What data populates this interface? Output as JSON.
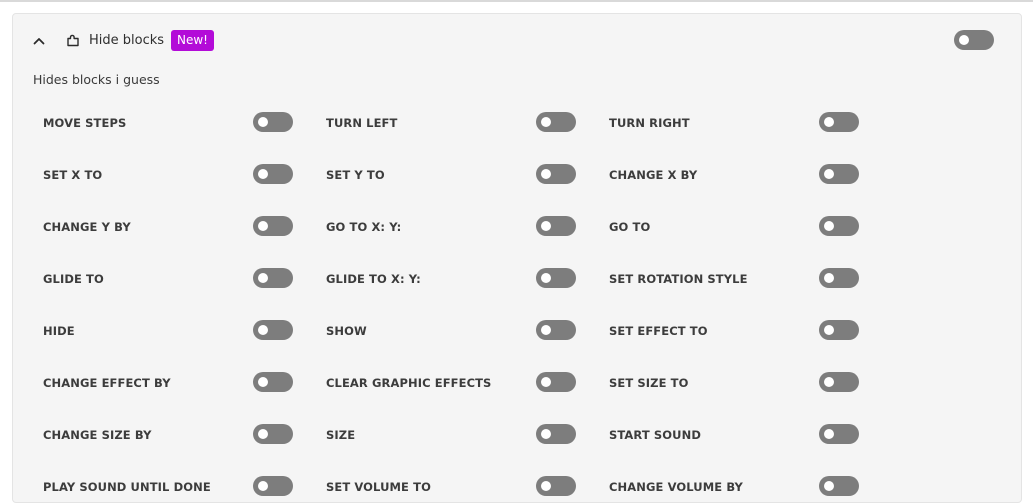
{
  "addon": {
    "name": "Hide blocks",
    "badge": "New!",
    "description": "Hides blocks i guess",
    "enabled": false
  },
  "colors": {
    "badge": "#b30bd8",
    "toggle_off": "#7d7d7d",
    "card_bg": "#f5f5f5"
  },
  "icons": {
    "collapse": "chevron-up-icon",
    "addon": "puzzle-icon"
  },
  "settings": [
    [
      {
        "label": "MOVE STEPS",
        "enabled": false
      },
      {
        "label": "TURN LEFT",
        "enabled": false
      },
      {
        "label": "TURN RIGHT",
        "enabled": false
      }
    ],
    [
      {
        "label": "SET X TO",
        "enabled": false
      },
      {
        "label": "SET Y TO",
        "enabled": false
      },
      {
        "label": "CHANGE X BY",
        "enabled": false
      }
    ],
    [
      {
        "label": "CHANGE Y BY",
        "enabled": false
      },
      {
        "label": "GO TO X: Y:",
        "enabled": false
      },
      {
        "label": "GO TO",
        "enabled": false
      }
    ],
    [
      {
        "label": "GLIDE TO",
        "enabled": false
      },
      {
        "label": "GLIDE TO X: Y:",
        "enabled": false
      },
      {
        "label": "SET ROTATION STYLE",
        "enabled": false
      }
    ],
    [
      {
        "label": "HIDE",
        "enabled": false
      },
      {
        "label": "SHOW",
        "enabled": false
      },
      {
        "label": "SET EFFECT TO",
        "enabled": false
      }
    ],
    [
      {
        "label": "CHANGE EFFECT BY",
        "enabled": false
      },
      {
        "label": "CLEAR GRAPHIC EFFECTS",
        "enabled": false
      },
      {
        "label": "SET SIZE TO",
        "enabled": false
      }
    ],
    [
      {
        "label": "CHANGE SIZE BY",
        "enabled": false
      },
      {
        "label": "SIZE",
        "enabled": false
      },
      {
        "label": "START SOUND",
        "enabled": false
      }
    ],
    [
      {
        "label": "PLAY SOUND UNTIL DONE",
        "enabled": false
      },
      {
        "label": "SET VOLUME TO",
        "enabled": false
      },
      {
        "label": "CHANGE VOLUME BY",
        "enabled": false
      }
    ]
  ]
}
